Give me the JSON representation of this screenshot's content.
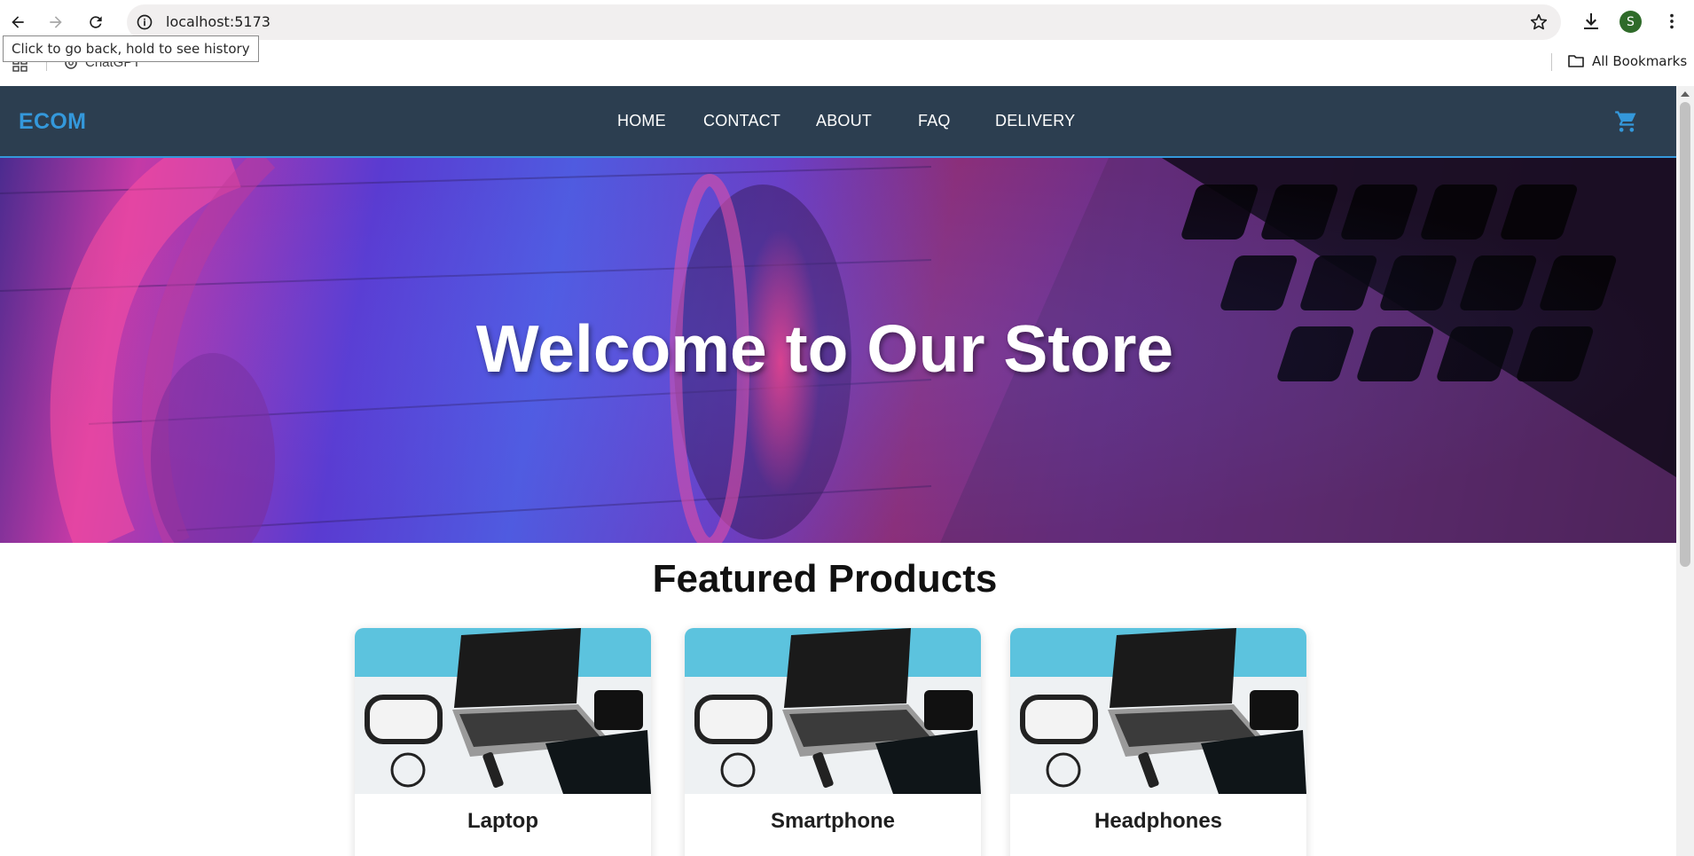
{
  "browser": {
    "url": "localhost:5173",
    "tooltip": "Click to go back, hold to see history",
    "avatar_initial": "S",
    "bookmarks": [
      {
        "label": "ChatGPT",
        "icon": "chatgpt-icon"
      }
    ],
    "all_bookmarks_label": "All Bookmarks"
  },
  "site": {
    "logo": "ECOM",
    "nav": [
      "HOME",
      "CONTACT",
      "ABOUT",
      "FAQ",
      "DELIVERY"
    ],
    "cart_icon": "cart-icon",
    "hero_title": "Welcome to Our Store",
    "featured_title": "Featured Products",
    "products": [
      {
        "name": "Laptop"
      },
      {
        "name": "Smartphone"
      },
      {
        "name": "Headphones"
      }
    ]
  },
  "colors": {
    "header_bg": "#2c3e50",
    "accent": "#3498db",
    "avatar": "#2f6b2a"
  }
}
